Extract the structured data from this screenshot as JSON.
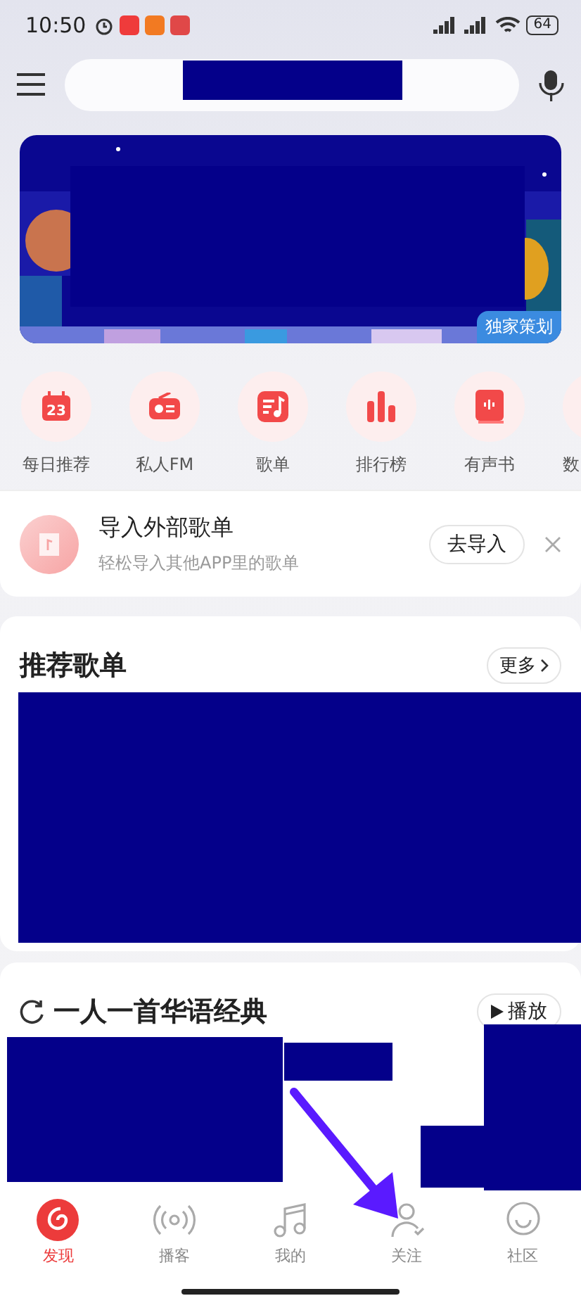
{
  "status_bar": {
    "time": "10:50",
    "battery": "64"
  },
  "banner": {
    "tag": "独家策划"
  },
  "shortcuts": [
    {
      "label": "每日推荐",
      "icon_text": "23"
    },
    {
      "label": "私人FM"
    },
    {
      "label": "歌单"
    },
    {
      "label": "排行榜"
    },
    {
      "label": "有声书"
    },
    {
      "label": "数"
    }
  ],
  "import_card": {
    "title": "导入外部歌单",
    "subtitle": "轻松导入其他APP里的歌单",
    "button": "去导入"
  },
  "recommended": {
    "title": "推荐歌单",
    "more": "更多"
  },
  "classics": {
    "title": "一人一首华语经典",
    "play": "播放"
  },
  "tabs": [
    {
      "label": "发现",
      "selected": true
    },
    {
      "label": "播客",
      "selected": false
    },
    {
      "label": "我的",
      "selected": false
    },
    {
      "label": "关注",
      "selected": false
    },
    {
      "label": "社区",
      "selected": false
    }
  ]
}
